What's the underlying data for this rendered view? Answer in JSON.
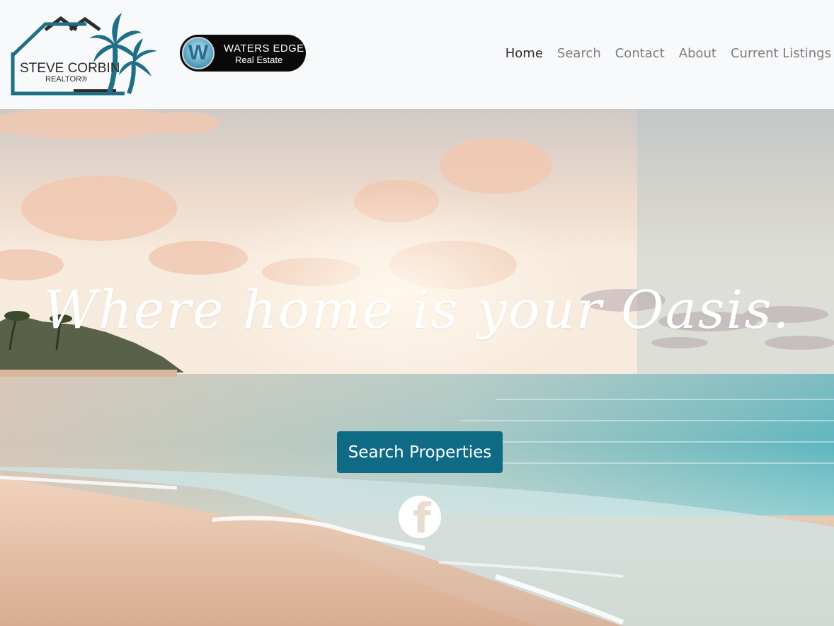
{
  "header": {
    "logo_main": {
      "name": "STEVE CORBIN",
      "title": "REALTOR®"
    },
    "logo_brand": {
      "letter": "W",
      "title": "WATERS EDGE",
      "subtitle": "Real Estate"
    }
  },
  "nav": {
    "items": [
      {
        "label": "Home",
        "active": true
      },
      {
        "label": "Search"
      },
      {
        "label": "Contact"
      },
      {
        "label": "About"
      },
      {
        "label": "Current Listings"
      }
    ]
  },
  "hero": {
    "tagline": "Where home is your Oasis.",
    "cta_label": "Search Properties",
    "social_icon": "facebook-icon",
    "social_glyph": "f"
  },
  "colors": {
    "accent": "#0e6a85",
    "logo_teal": "#1f6f86",
    "nav_active": "#2a2a2a",
    "nav_inactive": "#7c7c7c",
    "header_bg": "#f8f9fb"
  }
}
